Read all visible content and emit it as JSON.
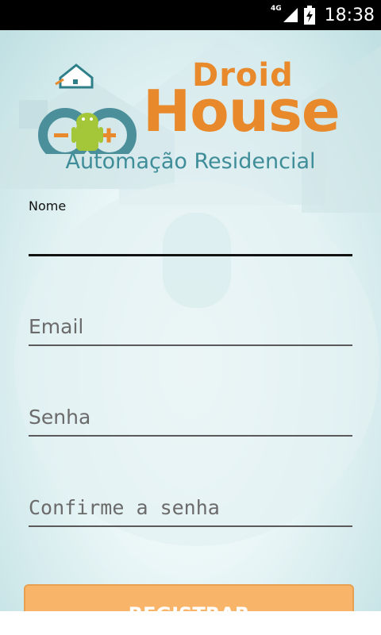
{
  "status_bar": {
    "network": "4G",
    "time": "18:38"
  },
  "logo": {
    "word_droid": "Droid",
    "word_house": "House"
  },
  "subtitle": "Automação Residencial",
  "form": {
    "name_label": "Nome",
    "email_placeholder": "Email",
    "password_placeholder": "Senha",
    "confirm_placeholder": "Confirme a senha"
  },
  "register_button": "REGISTRAR",
  "colors": {
    "accent_orange": "#e8892b",
    "teal": "#3e8d99",
    "button": "#f8b56a"
  }
}
